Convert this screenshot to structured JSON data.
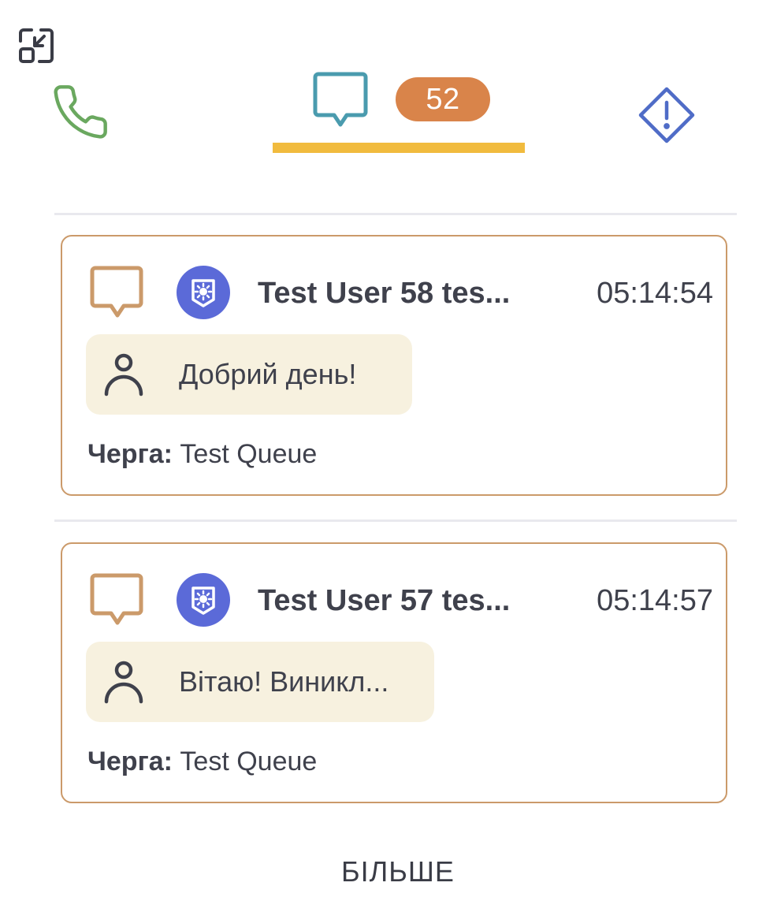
{
  "tabs": {
    "chat_badge_count": "52"
  },
  "colors": {
    "phone_green": "#6aa85f",
    "chat_teal": "#4a9bae",
    "alert_blue": "#4f6cc7",
    "badge_orange": "#d9844a",
    "underline_yellow": "#f1bb3e",
    "card_border": "#cb9a6a",
    "bubble_bg": "#f7f1df",
    "channel_purple": "#5b6ad8"
  },
  "conversations": [
    {
      "name": "Test User 58 tes...",
      "time": "05:14:54",
      "last_message": "Добрий день!",
      "queue_label": "Черга:",
      "queue_value": "Test Queue"
    },
    {
      "name": "Test User 57 tes...",
      "time": "05:14:57",
      "last_message": "Вітаю! Виникл...",
      "queue_label": "Черга:",
      "queue_value": "Test Queue"
    }
  ],
  "more_button": "БІЛЬШЕ"
}
